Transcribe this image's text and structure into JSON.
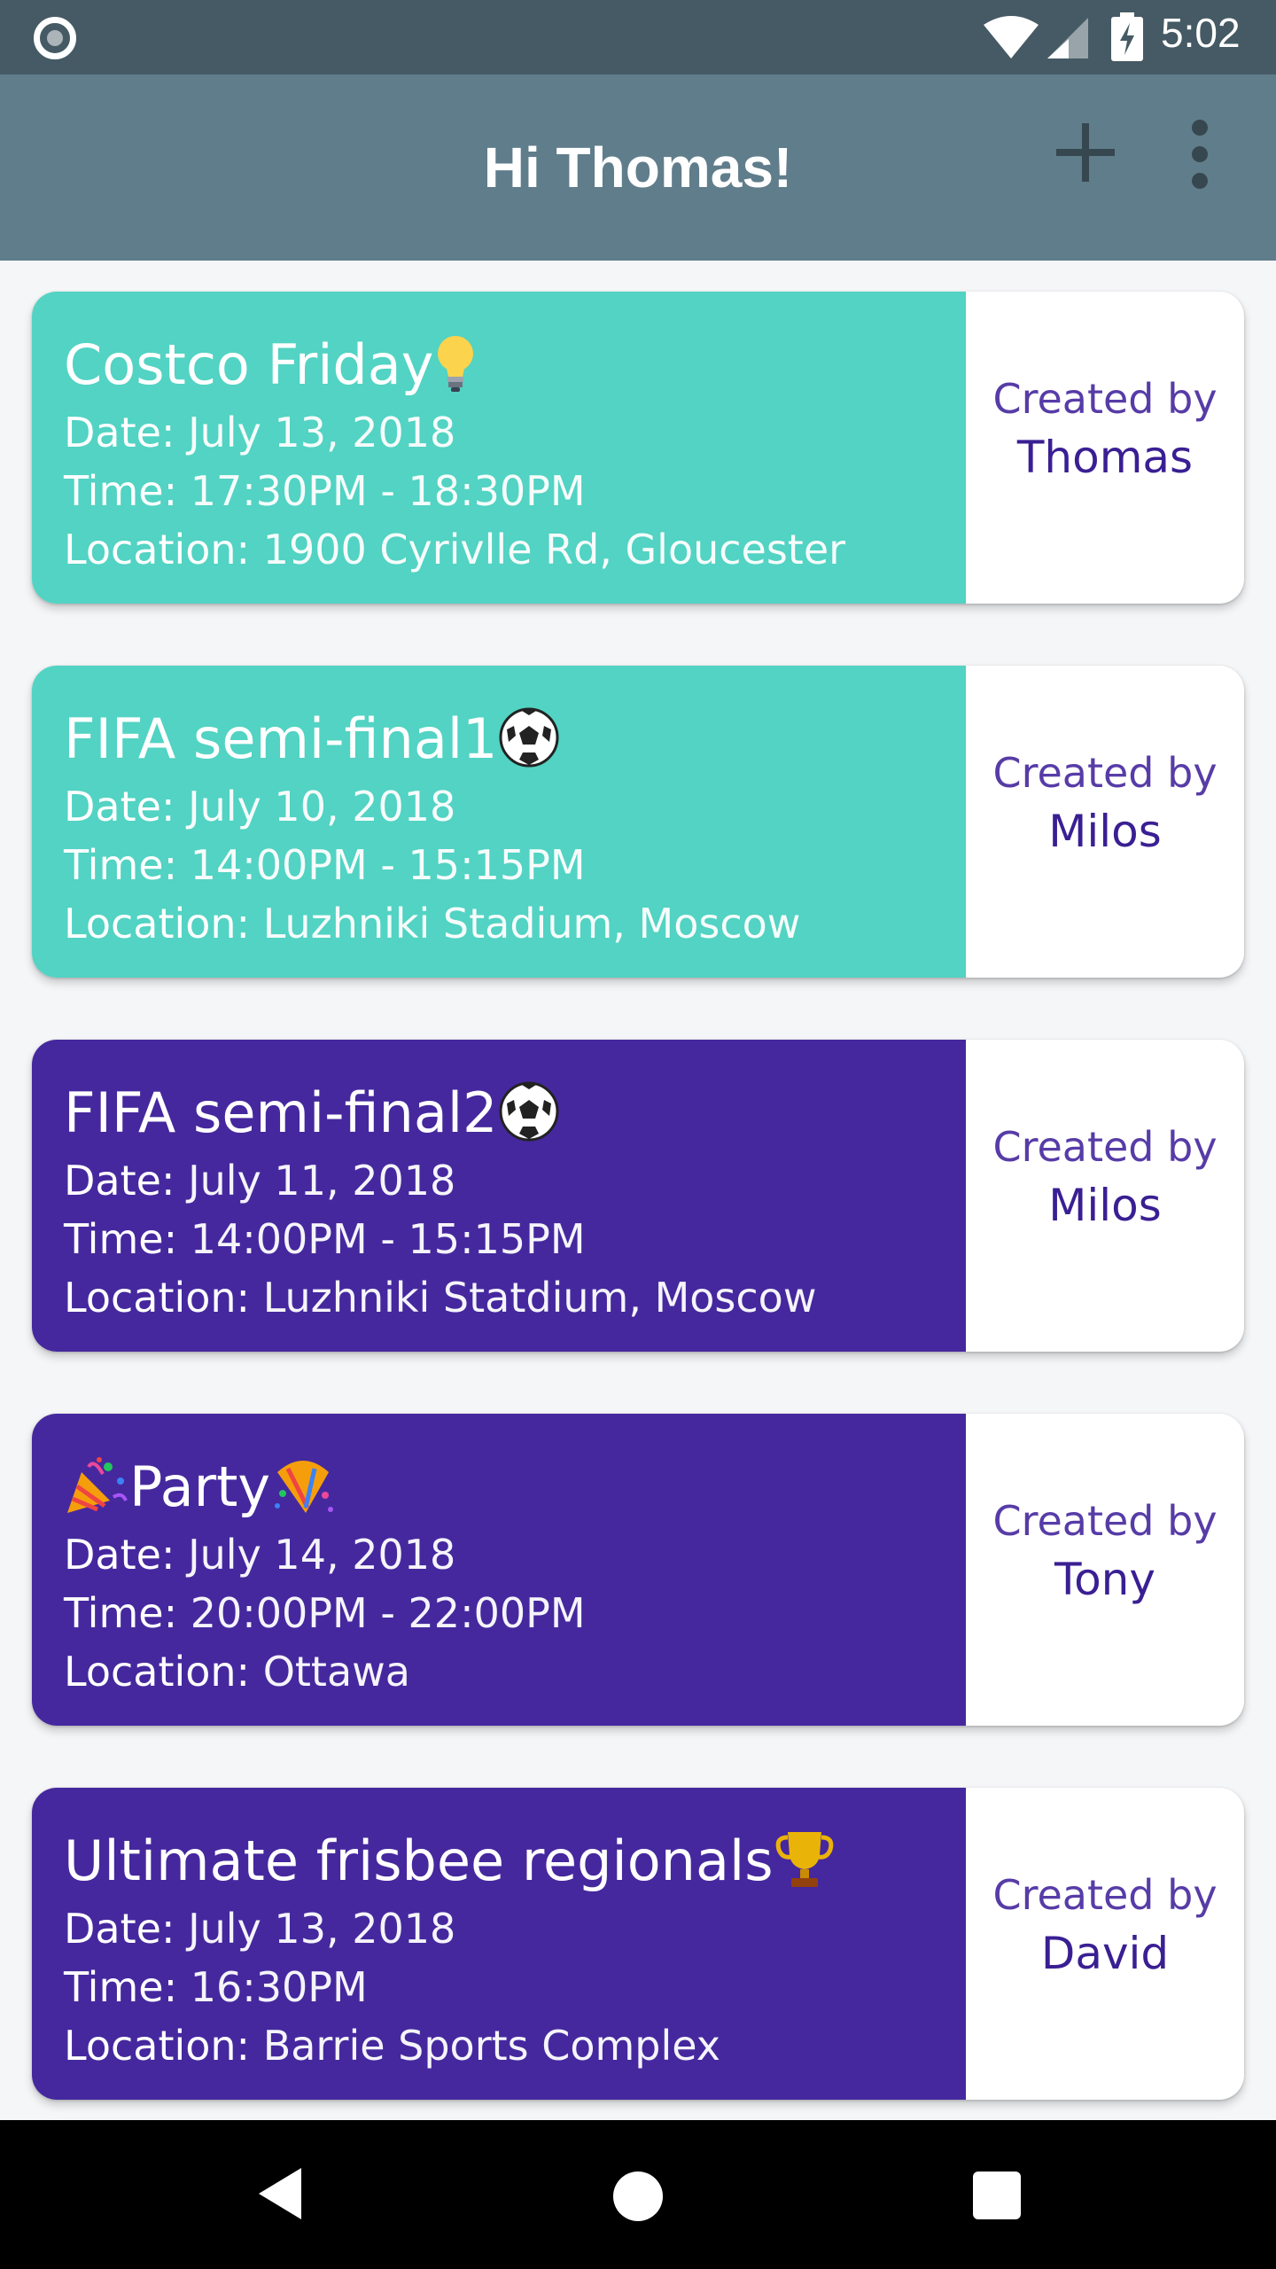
{
  "status_bar": {
    "time": "5:02"
  },
  "app_bar": {
    "title": "Hi Thomas!"
  },
  "events": [
    {
      "title": "Costco Friday",
      "emoji_after": "bulb-icon",
      "date_label": "Date:",
      "date": "July 13, 2018",
      "time_label": "Time:",
      "time": "17:30PM - 18:30PM",
      "location_label": "Location:",
      "location": "1900 Cyrivlle Rd, Gloucester",
      "created_by_label": "Created by",
      "creator": "Thomas",
      "color": "#52d3c3"
    },
    {
      "title": "FIFA semi-final1",
      "emoji_after": "soccer-ball-icon",
      "date_label": "Date:",
      "date": "July 10, 2018",
      "time_label": "Time:",
      "time": "14:00PM - 15:15PM",
      "location_label": "Location:",
      "location": "Luzhniki Stadium, Moscow",
      "created_by_label": "Created by",
      "creator": "Milos",
      "color": "#52d3c3"
    },
    {
      "title": "FIFA semi-final2",
      "emoji_after": "soccer-ball-icon",
      "date_label": "Date:",
      "date": "July 11, 2018",
      "time_label": "Time:",
      "time": "14:00PM - 15:15PM",
      "location_label": "Location:",
      "location": "Luzhniki Statdium, Moscow",
      "created_by_label": "Created by",
      "creator": "Milos",
      "color": "#45289e"
    },
    {
      "title": "Party",
      "emoji_before": "party-popper-icon",
      "emoji_after": "confetti-icon",
      "date_label": "Date:",
      "date": "July 14, 2018",
      "time_label": "Time:",
      "time": "20:00PM - 22:00PM",
      "location_label": "Location:",
      "location": "Ottawa",
      "created_by_label": "Created by",
      "creator": "Tony",
      "color": "#45289e"
    },
    {
      "title": "Ultimate frisbee regionals",
      "emoji_after": "trophy-icon",
      "date_label": "Date:",
      "date": "July 13, 2018",
      "time_label": "Time:",
      "time": "16:30PM",
      "location_label": "Location:",
      "location": "Barrie Sports Complex",
      "created_by_label": "Created by",
      "creator": "David",
      "color": "#45289e"
    }
  ],
  "colors": {
    "status_bar": "#455a64",
    "app_bar": "#607d8b",
    "teal": "#52d3c3",
    "purple": "#45289e",
    "background": "#f5f6f8"
  }
}
